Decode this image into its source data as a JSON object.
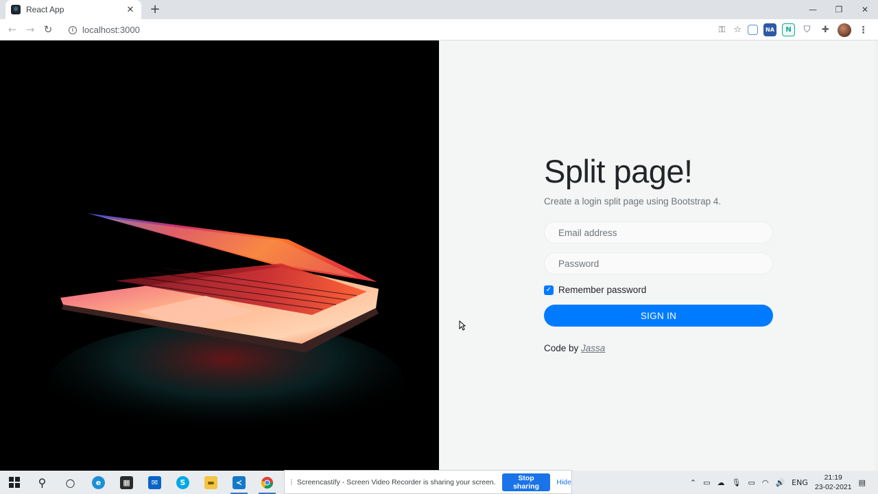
{
  "browser": {
    "tab_title": "React App",
    "tab_close": "✕",
    "new_tab": "+",
    "window_controls": {
      "minimize": "—",
      "maximize": "❐",
      "close": "✕"
    },
    "nav": {
      "back": "←",
      "forward": "→",
      "reload": "↻"
    },
    "url": "localhost:3000",
    "extensions": [
      "key-icon",
      "star-icon",
      "extension-1-icon",
      "extension-na-icon",
      "extension-n-icon",
      "shield-icon",
      "puzzle-icon",
      "avatar",
      "menu-icon"
    ],
    "ext_labels": {
      "na": "NA",
      "n": "N"
    }
  },
  "page": {
    "title": "Split page!",
    "subtitle": "Create a login split page using Bootstrap 4.",
    "email_placeholder": "Email address",
    "password_placeholder": "Password",
    "remember_label": "Remember password",
    "remember_checked": true,
    "signin_label": "SIGN IN",
    "credit_prefix": "Code by ",
    "credit_author": "Jassa",
    "hero_image": "laptop-glowing-keyboard-photo"
  },
  "share_bar": {
    "message": "Screencastify - Screen Video Recorder is sharing your screen.",
    "stop_label": "Stop sharing",
    "hide_label": "Hide"
  },
  "taskbar": {
    "apps": [
      "windows-start-icon",
      "search-icon",
      "cortana-icon",
      "edge-icon",
      "store-icon",
      "mail-icon",
      "skype-icon",
      "file-explorer-icon",
      "vscode-icon",
      "chrome-icon"
    ],
    "tray_lang": "ENG",
    "time": "21:19",
    "date": "23-02-2021"
  }
}
